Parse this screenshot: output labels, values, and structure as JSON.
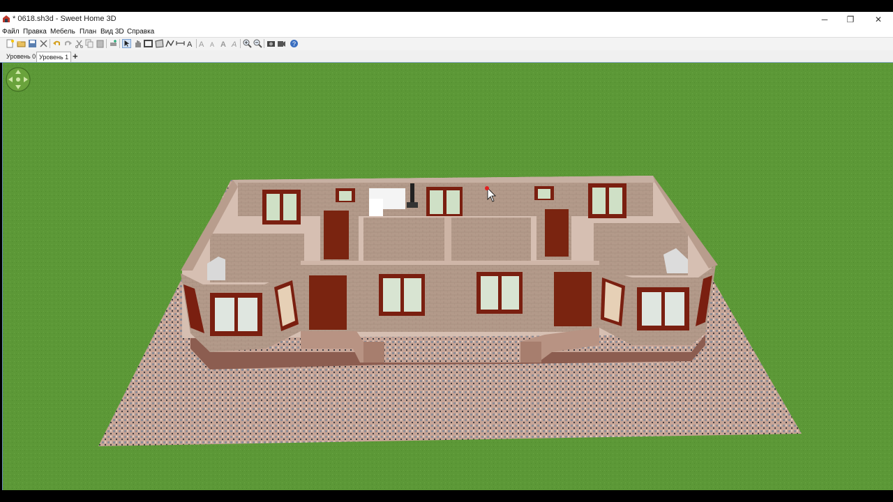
{
  "window": {
    "title": "* 0618.sh3d - Sweet Home 3D",
    "minimize_glyph": "─",
    "maximize_glyph": "❐",
    "close_glyph": "✕"
  },
  "menu": {
    "items": [
      "Файл",
      "Правка",
      "Мебель",
      "План",
      "Вид 3D",
      "Справка"
    ]
  },
  "toolbar": {
    "icons": [
      "new-home-icon",
      "open-icon",
      "save-icon",
      "cut-icon",
      "undo-icon",
      "redo-icon",
      "cut-icon",
      "copy-icon",
      "paste-icon",
      "add-furniture-icon",
      "select-icon",
      "pan-icon",
      "create-walls-icon",
      "create-rooms-icon",
      "create-polylines-icon",
      "create-dimensions-icon",
      "add-text-icon",
      "increase-text-icon",
      "decrease-text-icon",
      "bold-text-icon",
      "italic-text-icon",
      "zoom-in-icon",
      "zoom-out-icon",
      "create-photo-icon",
      "create-video-icon",
      "help-icon"
    ]
  },
  "levels": {
    "tabs": [
      "Уровень 0",
      "Уровень 1"
    ],
    "active": "Уровень 1",
    "add_glyph": "+"
  },
  "colors": {
    "grass": "#5f9a3a",
    "wall_exterior": "#b09585",
    "floor": "#d8c2b5",
    "window_frame": "#7a1f10",
    "door": "#7a2410",
    "foundation": "#8a5a4e",
    "paving": "#c9a898"
  }
}
